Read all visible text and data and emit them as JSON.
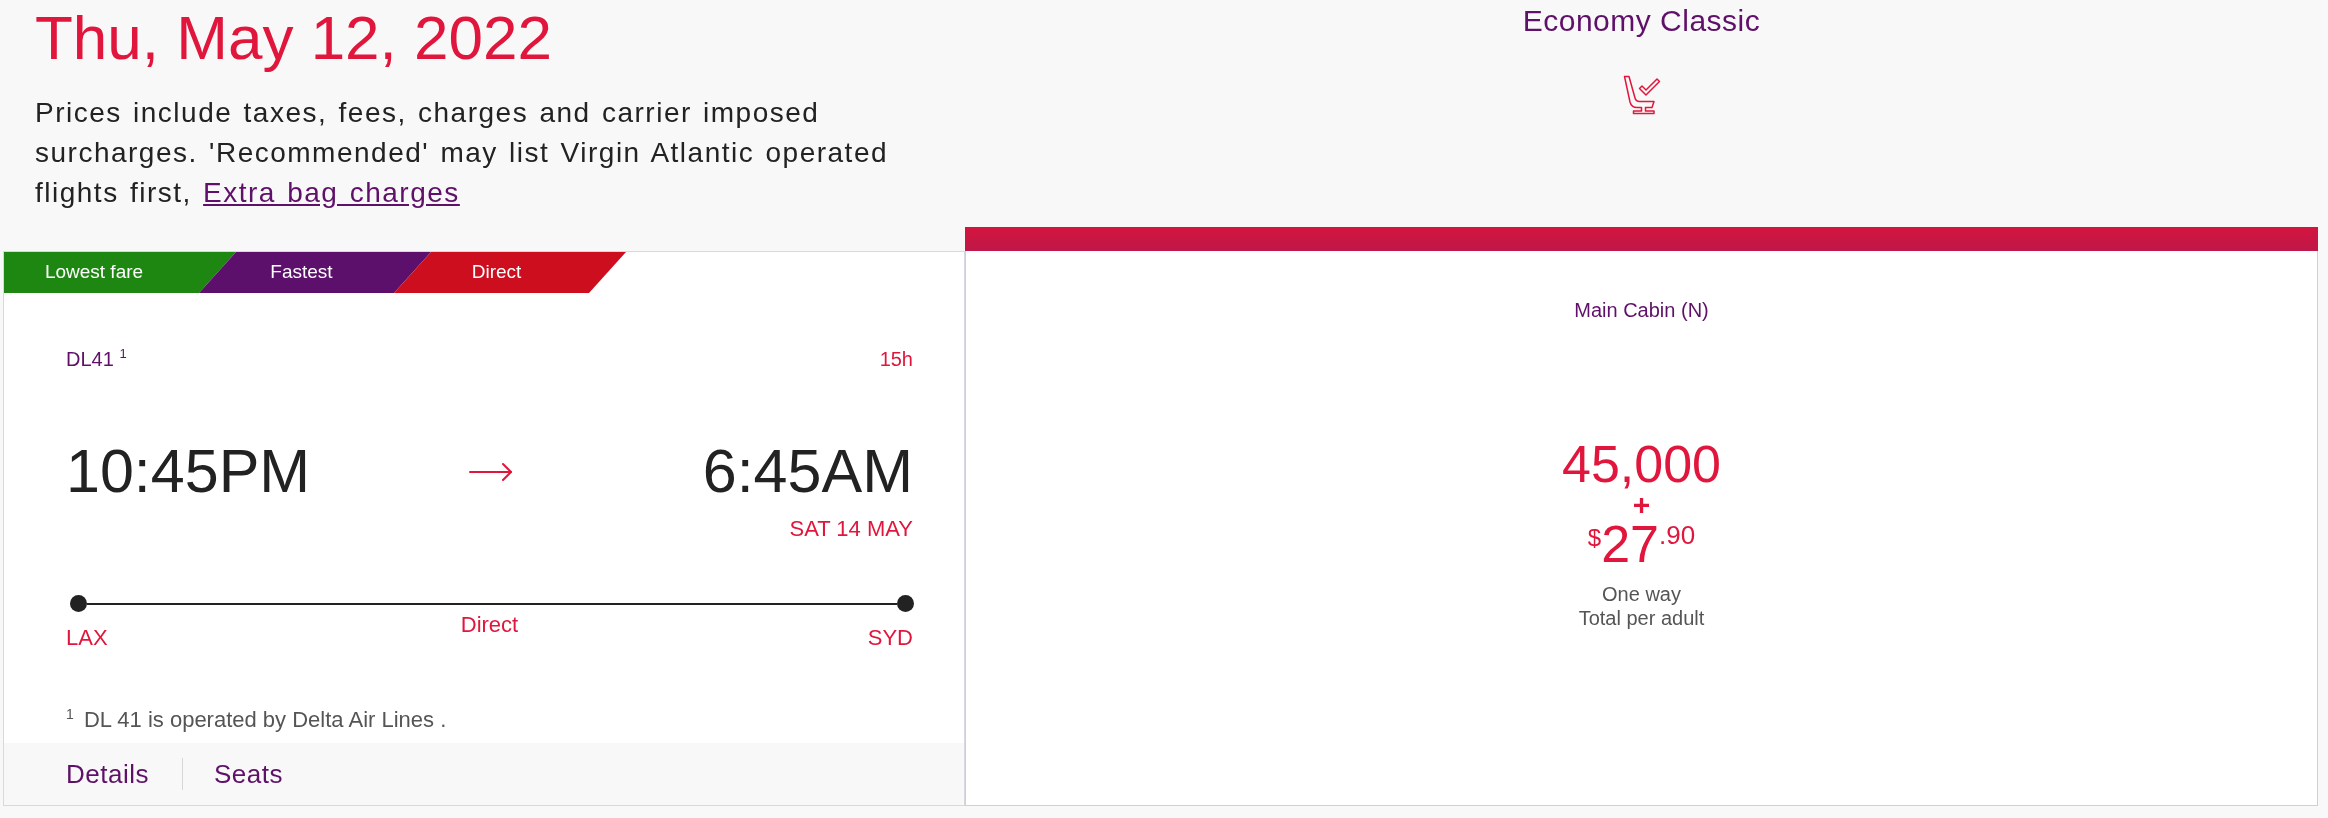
{
  "header": {
    "date": "Thu, May 12, 2022",
    "notice": "Prices include taxes, fees, charges and carrier imposed surcharges. 'Recommended' may list Virgin Atlantic operated flights first,",
    "notice_link": "Extra bag charges"
  },
  "fare_class": {
    "title": "Economy Classic"
  },
  "flight": {
    "tags": [
      {
        "label": "Lowest fare",
        "color": "#1e8712"
      },
      {
        "label": "Fastest",
        "color": "#5c0f6b"
      },
      {
        "label": "Direct",
        "color": "#cc0e1e"
      }
    ],
    "number": "DL41 $^{1}$",
    "duration": "15h",
    "depart_time": "10:45PM",
    "arrive_time": "6:45AM",
    "arrive_date": "SAT 14 MAY",
    "origin": "LAX",
    "stops": "Direct",
    "destination": "SYD",
    "footnote": "$^{1}$ DL 41 is operated by Delta Air Lines .",
    "links": [
      {
        "label": "Details"
      },
      {
        "label": "Seats"
      }
    ]
  },
  "fare": {
    "cabin": "Main Cabin (N)",
    "points": "45,000",
    "plus": "+",
    "currency": "$",
    "amount": "27",
    "cents": ".90",
    "trip_type": "One way",
    "price_basis": "Total per adult"
  }
}
